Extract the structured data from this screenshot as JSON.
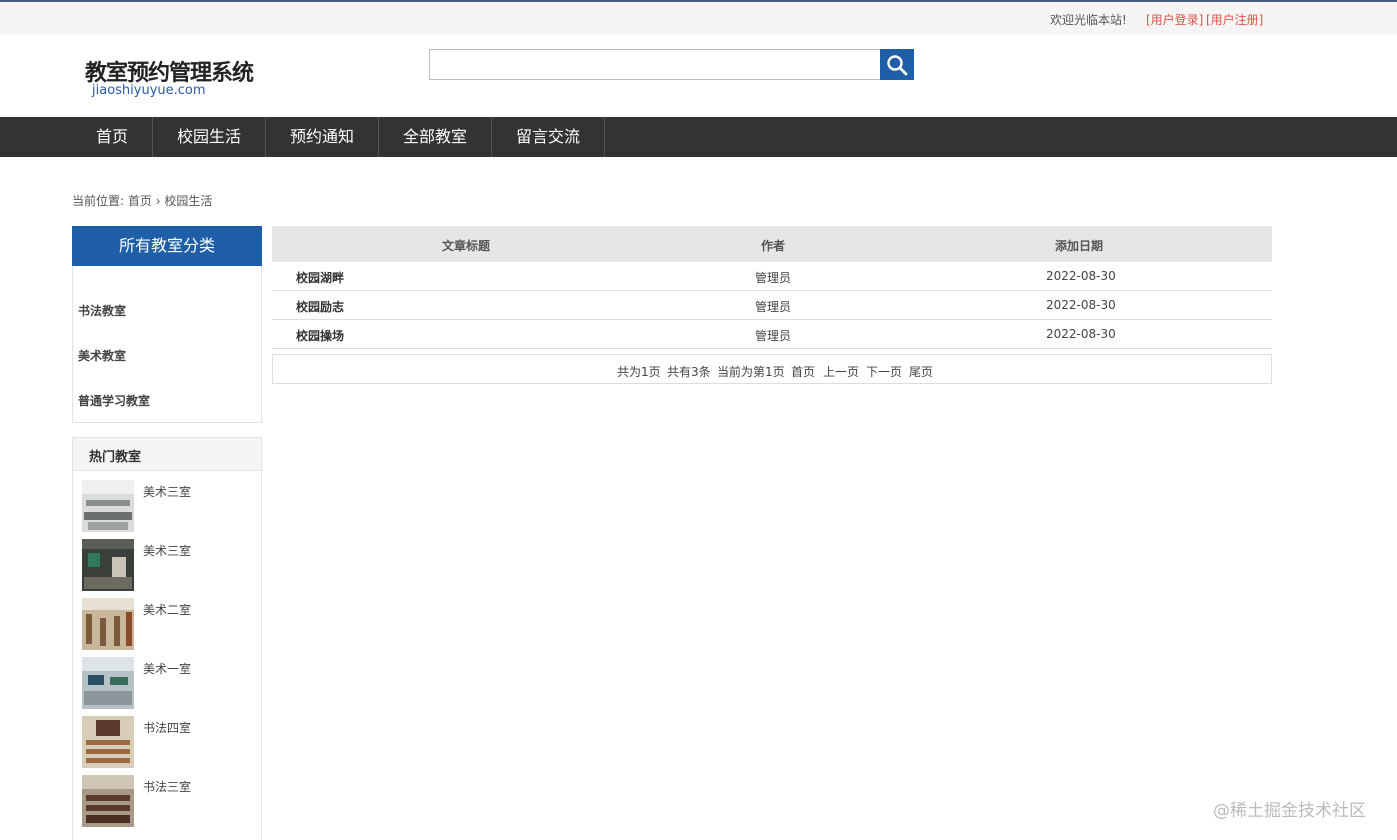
{
  "topbar": {
    "welcome": "欢迎光临本站!",
    "login": "[用户登录]",
    "register": "[用户注册]"
  },
  "header": {
    "title": "教室预约管理系统",
    "subtitle": "jiaoshiyuyue.com",
    "search_icon": "search-icon"
  },
  "nav": {
    "items": [
      "首页",
      "校园生活",
      "预约通知",
      "全部教室",
      "留言交流"
    ]
  },
  "breadcrumb": {
    "prefix": "当前位置:",
    "home": "首页",
    "separator": "›",
    "current": "校园生活"
  },
  "sidebar": {
    "category_title": "所有教室分类",
    "categories": [
      "书法教室",
      "美术教室",
      "普通学习教室"
    ],
    "hot_title": "热门教室",
    "hot_rooms": [
      "美术三室",
      "美术三室",
      "美术二室",
      "美术一室",
      "书法四室",
      "书法三室"
    ]
  },
  "table": {
    "headers": [
      "文章标题",
      "作者",
      "添加日期"
    ],
    "rows": [
      {
        "title": "校园湖畔",
        "author": "管理员",
        "date": "2022-08-30"
      },
      {
        "title": "校园励志",
        "author": "管理员",
        "date": "2022-08-30"
      },
      {
        "title": "校园操场",
        "author": "管理员",
        "date": "2022-08-30"
      }
    ]
  },
  "pager": {
    "total_pages": "共为1页",
    "total_items": "共有3条",
    "current": "当前为第1页",
    "first": "首页",
    "prev": "上一页",
    "next": "下一页",
    "last": "尾页"
  },
  "watermark": "@稀土掘金技术社区",
  "colors": {
    "brand": "#1e5fa8",
    "nav": "#333333",
    "link_red": "#e0534a"
  }
}
